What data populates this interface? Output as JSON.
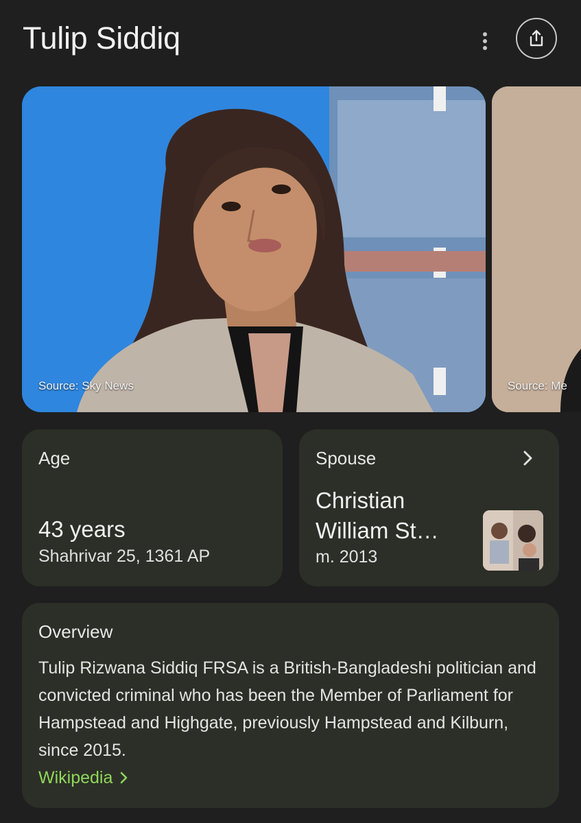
{
  "header": {
    "title": "Tulip Siddiq"
  },
  "images": [
    {
      "source": "Source: Sky News"
    },
    {
      "source": "Source: Me"
    }
  ],
  "age_card": {
    "label": "Age",
    "value": "43 years",
    "sub": "Shahrivar 25, 1361 AP"
  },
  "spouse_card": {
    "label": "Spouse",
    "name": "Christian William St…",
    "sub": "m. 2013"
  },
  "overview": {
    "title": "Overview",
    "text": "Tulip Rizwana Siddiq FRSA is a British-Bangladeshi politician and convicted criminal who has been the Member of Parliament for Hampstead and Highgate, previously Hampstead and Kilburn, since 2015.",
    "link_label": "Wikipedia"
  },
  "colors": {
    "background": "#1f1f1f",
    "card": "#2c2f27",
    "link": "#8fd65a"
  },
  "icons": [
    "more-vert-icon",
    "share-icon",
    "chevron-right-icon"
  ]
}
